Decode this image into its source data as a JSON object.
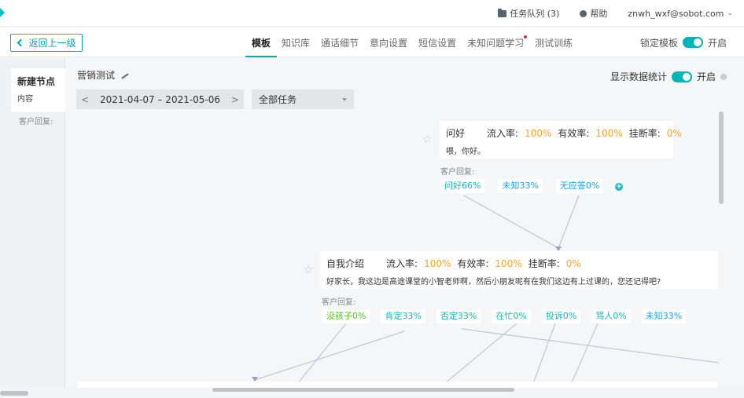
{
  "topbar": {
    "task_queue": "任务队列 (3)",
    "help": "帮助",
    "user": "znwh_wxf@sobot.com"
  },
  "nav": {
    "back": "返回上一级",
    "tabs": [
      {
        "label": "模板",
        "active": true
      },
      {
        "label": "知识库"
      },
      {
        "label": "通话细节"
      },
      {
        "label": "意向设置"
      },
      {
        "label": "短信设置"
      },
      {
        "label": "未知问题学习",
        "dot": true
      },
      {
        "label": "测试训练"
      }
    ],
    "lock_label": "锁定模板",
    "lock_state": "开启"
  },
  "left": {
    "node_title": "新建节点",
    "node_sub": "内容",
    "reply_label": "客户回复:"
  },
  "main": {
    "flow_title": "营销测试",
    "date_range": "2021-04-07 – 2021-05-06",
    "date_prev": "<",
    "date_next": ">",
    "task_filter": "全部任务",
    "stats_label": "显示数据统计",
    "stats_state": "开启"
  },
  "node1": {
    "name": "问好",
    "inflow_label": "流入率:",
    "inflow": "100%",
    "valid_label": "有效率:",
    "valid": "100%",
    "hangup_label": "挂断率:",
    "hangup": "0%",
    "content": "喂，你好。",
    "reply_label": "客户回复:",
    "chips": [
      "问好66%",
      "未知33%",
      "无应答0%"
    ]
  },
  "node2": {
    "name": "自我介绍",
    "inflow_label": "流入率:",
    "inflow": "100%",
    "valid_label": "有效率:",
    "valid": "100%",
    "hangup_label": "挂断率:",
    "hangup": "0%",
    "content": "好家长，我这边是高途课堂的小智老师啊，然后小朋友呢有在我们这边有上过课的，您还记得吧?",
    "reply_label": "客户回复:",
    "chips": [
      "没孩子0%",
      "肯定33%",
      "否定33%",
      "在忙0%",
      "投诉0%",
      "骂人0%",
      "未知33%"
    ]
  },
  "colors": {
    "accent": "#00b3b9",
    "rate": "#f5a623",
    "chip_teal": "#14b5b1",
    "chip_green": "#52c41a",
    "chip_blue": "#1aa3e8"
  }
}
